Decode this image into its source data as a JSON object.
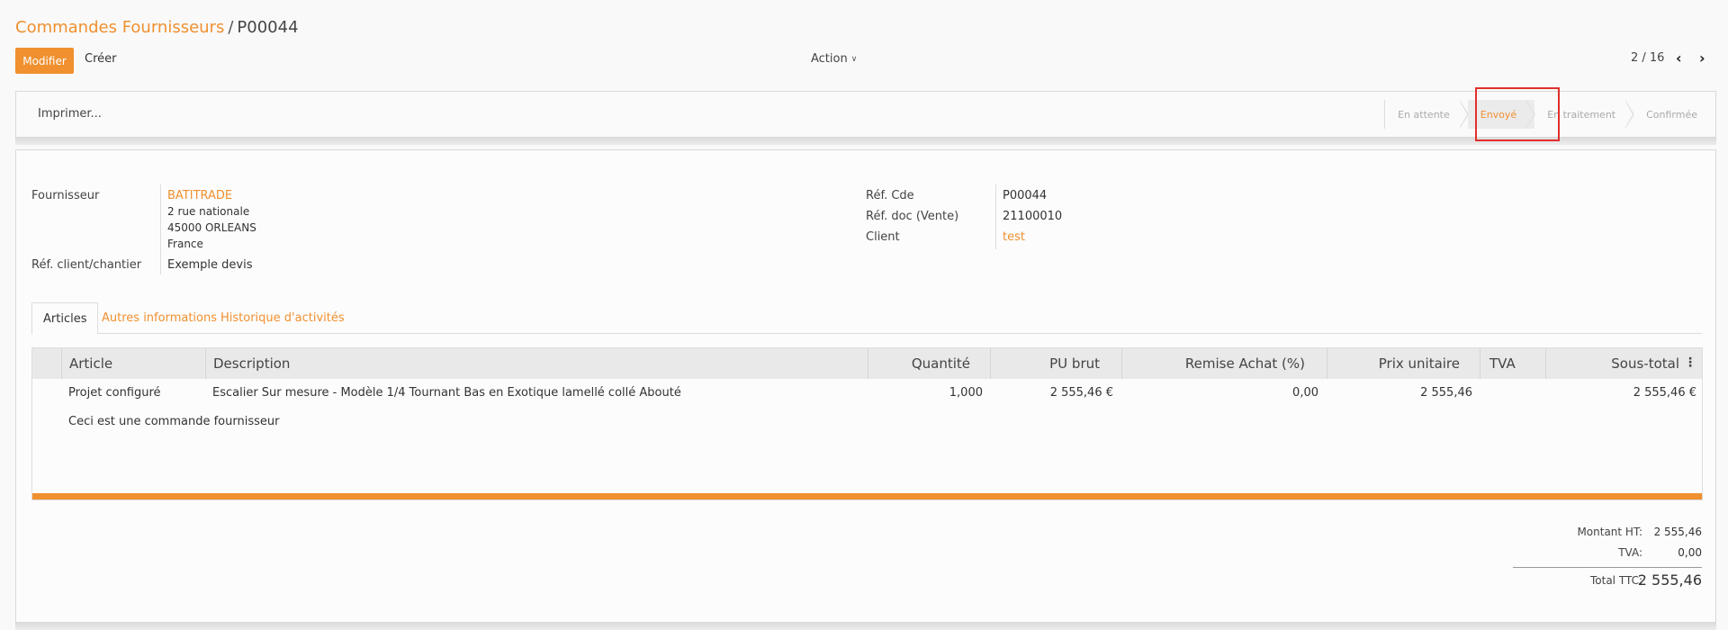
{
  "breadcrumb": {
    "parent": "Commandes Fournisseurs",
    "separator": "/",
    "current": "P00044"
  },
  "toolbar": {
    "edit_label": "Modifier",
    "create_label": "Créer",
    "action_label": "Action",
    "pager_text": "2 / 16"
  },
  "statusbar": {
    "print_label": "Imprimer...",
    "stages": [
      {
        "label": "En attente",
        "active": false
      },
      {
        "label": "Envoyé",
        "active": true
      },
      {
        "label": "En traitement",
        "active": false
      },
      {
        "label": "Confirmée",
        "active": false
      }
    ]
  },
  "form": {
    "supplier_label": "Fournisseur",
    "supplier_name": "BATITRADE",
    "supplier_address_1": "2 rue nationale",
    "supplier_address_2": "45000 ORLEANS",
    "supplier_address_3": "France",
    "client_ref_label": "Réf. client/chantier",
    "client_ref_value": "Exemple devis",
    "order_ref_label": "Réf. Cde",
    "order_ref_value": "P00044",
    "sale_ref_label": "Réf. doc (Vente)",
    "sale_ref_value": "21100010",
    "client_label": "Client",
    "client_value": "test"
  },
  "tabs": [
    "Articles",
    "Autres informations",
    "Historique d'activités"
  ],
  "table": {
    "headers": [
      "Article",
      "Description",
      "Quantité",
      "PU brut",
      "Remise Achat (%)",
      "Prix unitaire",
      "TVA",
      "Sous-total"
    ],
    "rows": [
      {
        "article": "Projet configuré",
        "description": "Escalier Sur mesure - Modèle 1/4 Tournant Bas en Exotique lamellé collé Abouté",
        "quantity": "1,000",
        "pu_brut": "2 555,46 €",
        "discount": "0,00",
        "unit_price": "2 555,46",
        "tva": "",
        "subtotal": "2 555,46 €"
      }
    ],
    "note": "Ceci est une commande fournisseur"
  },
  "totals": {
    "ht_label": "Montant HT:",
    "ht_value": "2 555,46",
    "tva_label": "TVA:",
    "tva_value": "0,00",
    "ttc_label": "Total TTC:",
    "ttc_value": "2 555,46"
  },
  "colors": {
    "accent": "#f0902f",
    "highlight": "#e0302b"
  }
}
